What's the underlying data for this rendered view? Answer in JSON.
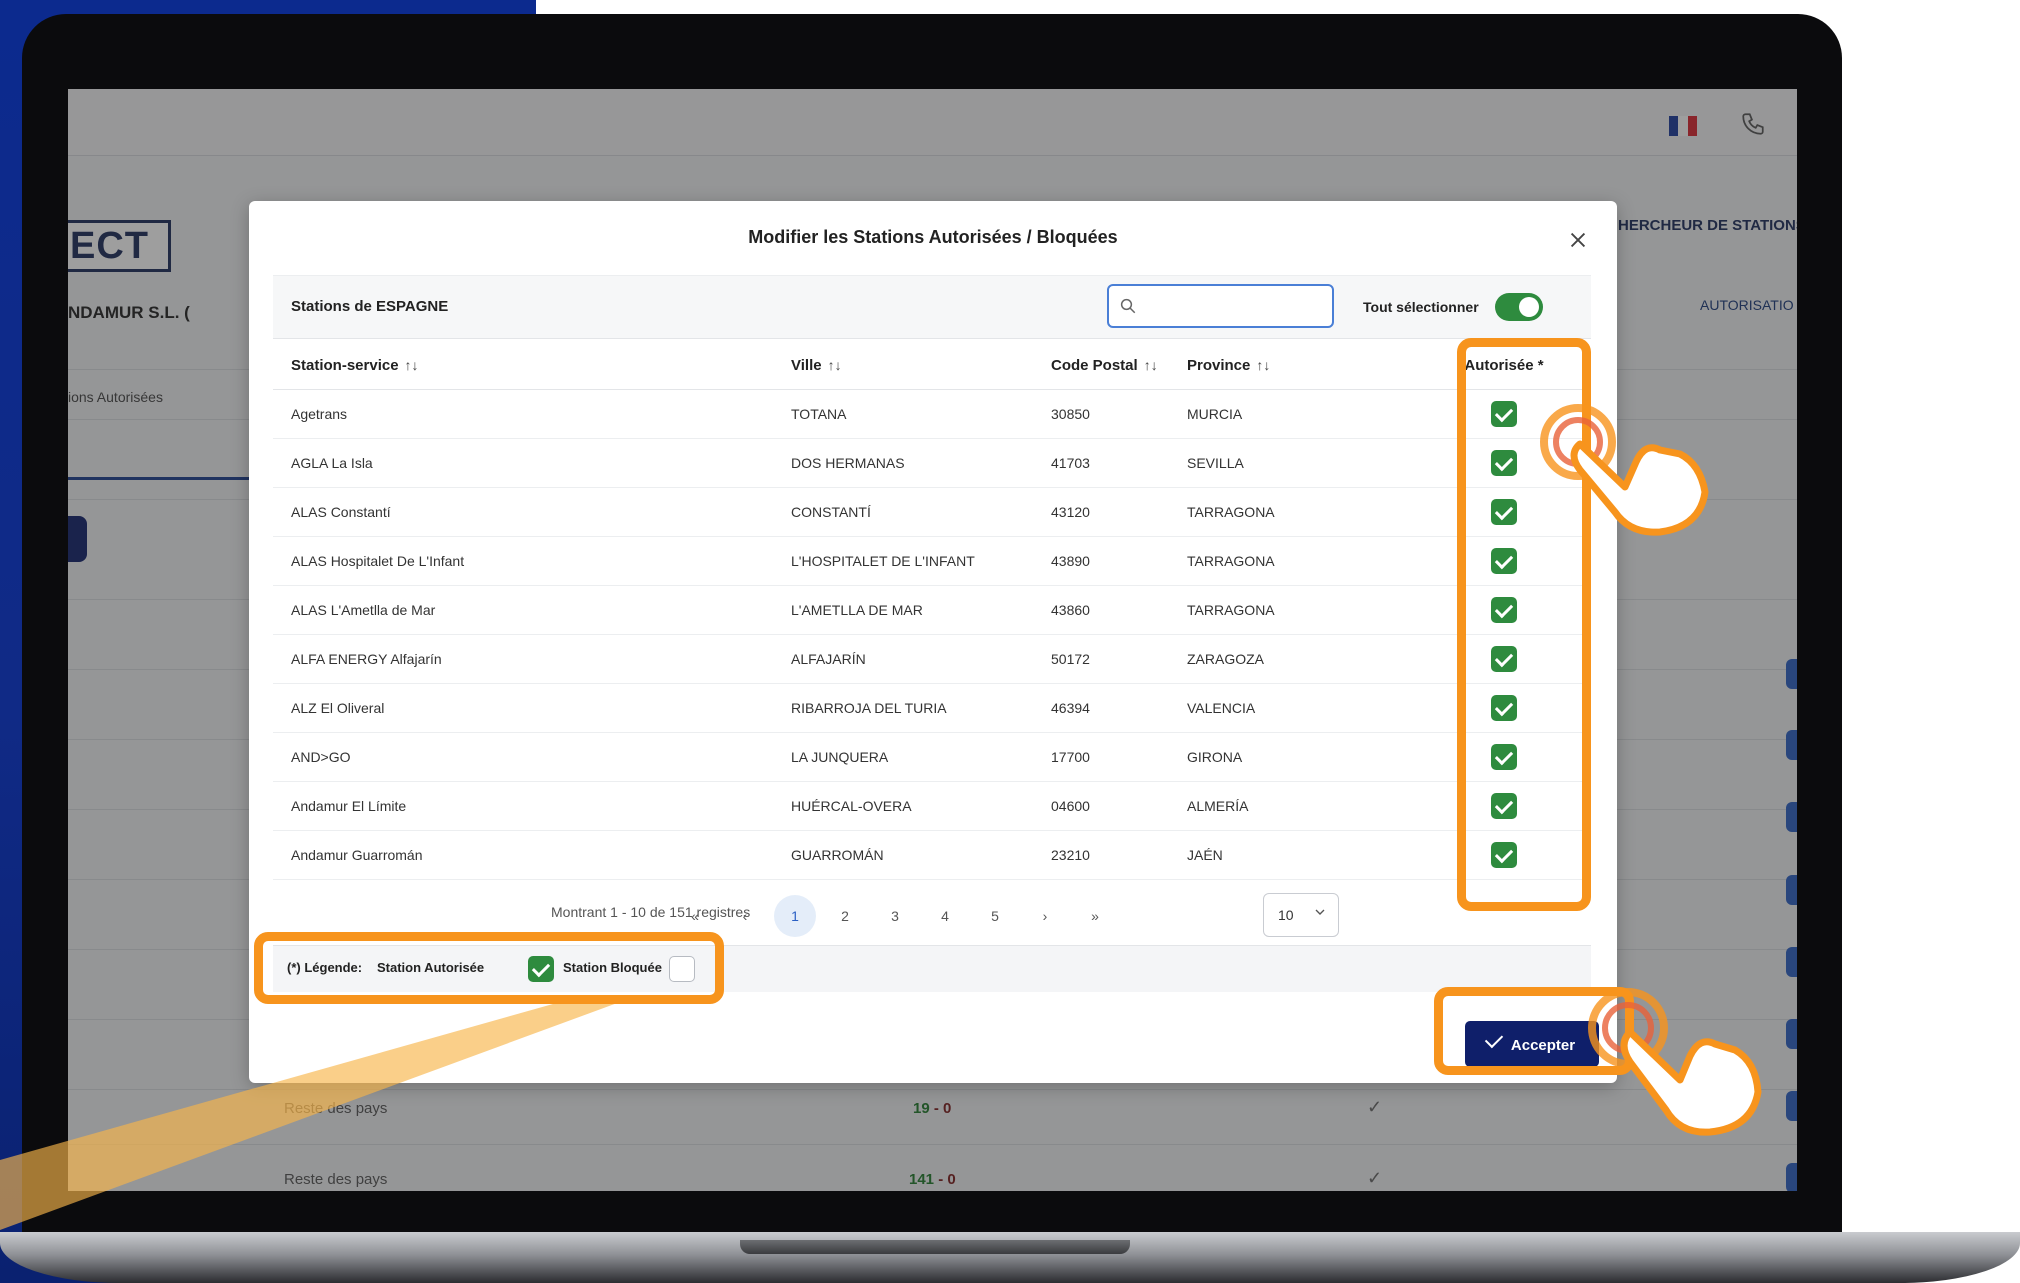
{
  "header": {
    "flag": "fr-flag",
    "phone_icon": "phone-icon"
  },
  "app": {
    "brand": "ECT",
    "company": "NDAMUR S.L. (",
    "side_link": "ions Autorisées",
    "right_search": "HERCHEUR DE STATIONS",
    "right_auth": "AUTORISATIO",
    "bg_rows": [
      {
        "label": "Reste des pays",
        "num_a": "19",
        "sep": " - ",
        "num_b": "0"
      },
      {
        "label": "Reste des pays",
        "num_a": "141",
        "sep": " - ",
        "num_b": "0"
      }
    ]
  },
  "modal": {
    "title": "Modifier les Stations Autorisées / Bloquées",
    "close_icon": "close-icon",
    "filter_title": "Stations de ESPAGNE",
    "search_placeholder": "",
    "select_all_label": "Tout sélectionner",
    "select_all_on": true,
    "columns": {
      "station": "Station-service",
      "ville": "Ville",
      "code_postal": "Code Postal",
      "province": "Province",
      "autorisee": "Autorisée *"
    },
    "sort_glyph": "↑↓",
    "rows": [
      {
        "station": "Agetrans",
        "ville": "TOTANA",
        "cp": "30850",
        "province": "MURCIA",
        "authorized": true
      },
      {
        "station": "AGLA La Isla",
        "ville": "DOS HERMANAS",
        "cp": "41703",
        "province": "SEVILLA",
        "authorized": true
      },
      {
        "station": "ALAS Constantí",
        "ville": "CONSTANTÍ",
        "cp": "43120",
        "province": "TARRAGONA",
        "authorized": true
      },
      {
        "station": "ALAS Hospitalet De L'Infant",
        "ville": "L'HOSPITALET DE L'INFANT",
        "cp": "43890",
        "province": "TARRAGONA",
        "authorized": true
      },
      {
        "station": "ALAS L'Ametlla de Mar",
        "ville": "L'AMETLLA DE MAR",
        "cp": "43860",
        "province": "TARRAGONA",
        "authorized": true
      },
      {
        "station": "ALFA ENERGY Alfajarín",
        "ville": "ALFAJARÍN",
        "cp": "50172",
        "province": "ZARAGOZA",
        "authorized": true
      },
      {
        "station": "ALZ El Oliveral",
        "ville": "RIBARROJA DEL TURIA",
        "cp": "46394",
        "province": "VALENCIA",
        "authorized": true
      },
      {
        "station": "AND>GO",
        "ville": "LA JUNQUERA",
        "cp": "17700",
        "province": "GIRONA",
        "authorized": true
      },
      {
        "station": "Andamur El Límite",
        "ville": "HUÉRCAL-OVERA",
        "cp": "04600",
        "province": "ALMERÍA",
        "authorized": true
      },
      {
        "station": "Andamur Guarromán",
        "ville": "GUARROMÁN",
        "cp": "23210",
        "province": "JAÉN",
        "authorized": true
      }
    ],
    "pagination": {
      "info": "Montrant 1 - 10 de 151 registres",
      "first": "«",
      "prev": "‹",
      "pages": [
        "1",
        "2",
        "3",
        "4",
        "5"
      ],
      "current": "1",
      "next": "›",
      "last": "»",
      "page_size": "10"
    },
    "legend": {
      "title": "(*) Légende:",
      "authorized": "Station Autorisée",
      "blocked": "Station Bloquée"
    },
    "accept_label": "Accepter"
  },
  "colors": {
    "accent_orange": "#f7941d",
    "check_green": "#2e8b3e",
    "primary_navy": "#0f1f6a",
    "side_blue": "#0c2a8e"
  }
}
